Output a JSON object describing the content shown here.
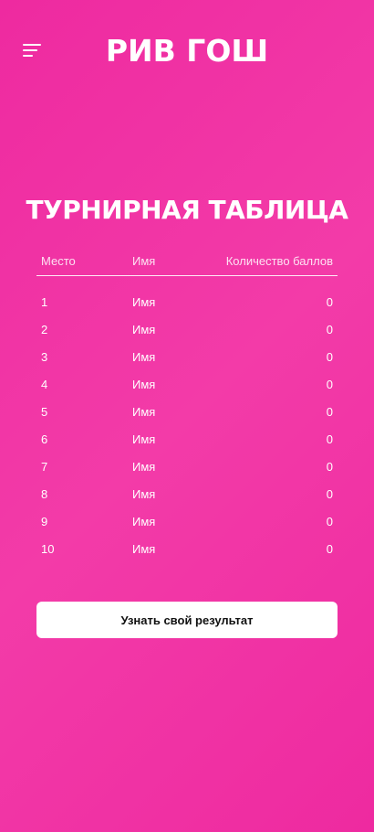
{
  "header": {
    "logo": "РИВ ГОШ"
  },
  "page": {
    "title": "ТУРНИРНАЯ ТАБЛИЦА"
  },
  "table": {
    "columns": {
      "place": "Место",
      "name": "Имя",
      "score": "Количество баллов"
    },
    "rows": [
      {
        "place": "1",
        "name": "Имя",
        "score": "0"
      },
      {
        "place": "2",
        "name": "Имя",
        "score": "0"
      },
      {
        "place": "3",
        "name": "Имя",
        "score": "0"
      },
      {
        "place": "4",
        "name": "Имя",
        "score": "0"
      },
      {
        "place": "5",
        "name": "Имя",
        "score": "0"
      },
      {
        "place": "6",
        "name": "Имя",
        "score": "0"
      },
      {
        "place": "7",
        "name": "Имя",
        "score": "0"
      },
      {
        "place": "8",
        "name": "Имя",
        "score": "0"
      },
      {
        "place": "9",
        "name": "Имя",
        "score": "0"
      },
      {
        "place": "10",
        "name": "Имя",
        "score": "0"
      }
    ]
  },
  "cta": {
    "label": "Узнать свой результат"
  },
  "icons": {
    "menu": "menu-icon"
  },
  "colors": {
    "background": "#ee2aa0",
    "text": "#ffffff",
    "button_bg": "#ffffff",
    "button_text": "#111111"
  }
}
